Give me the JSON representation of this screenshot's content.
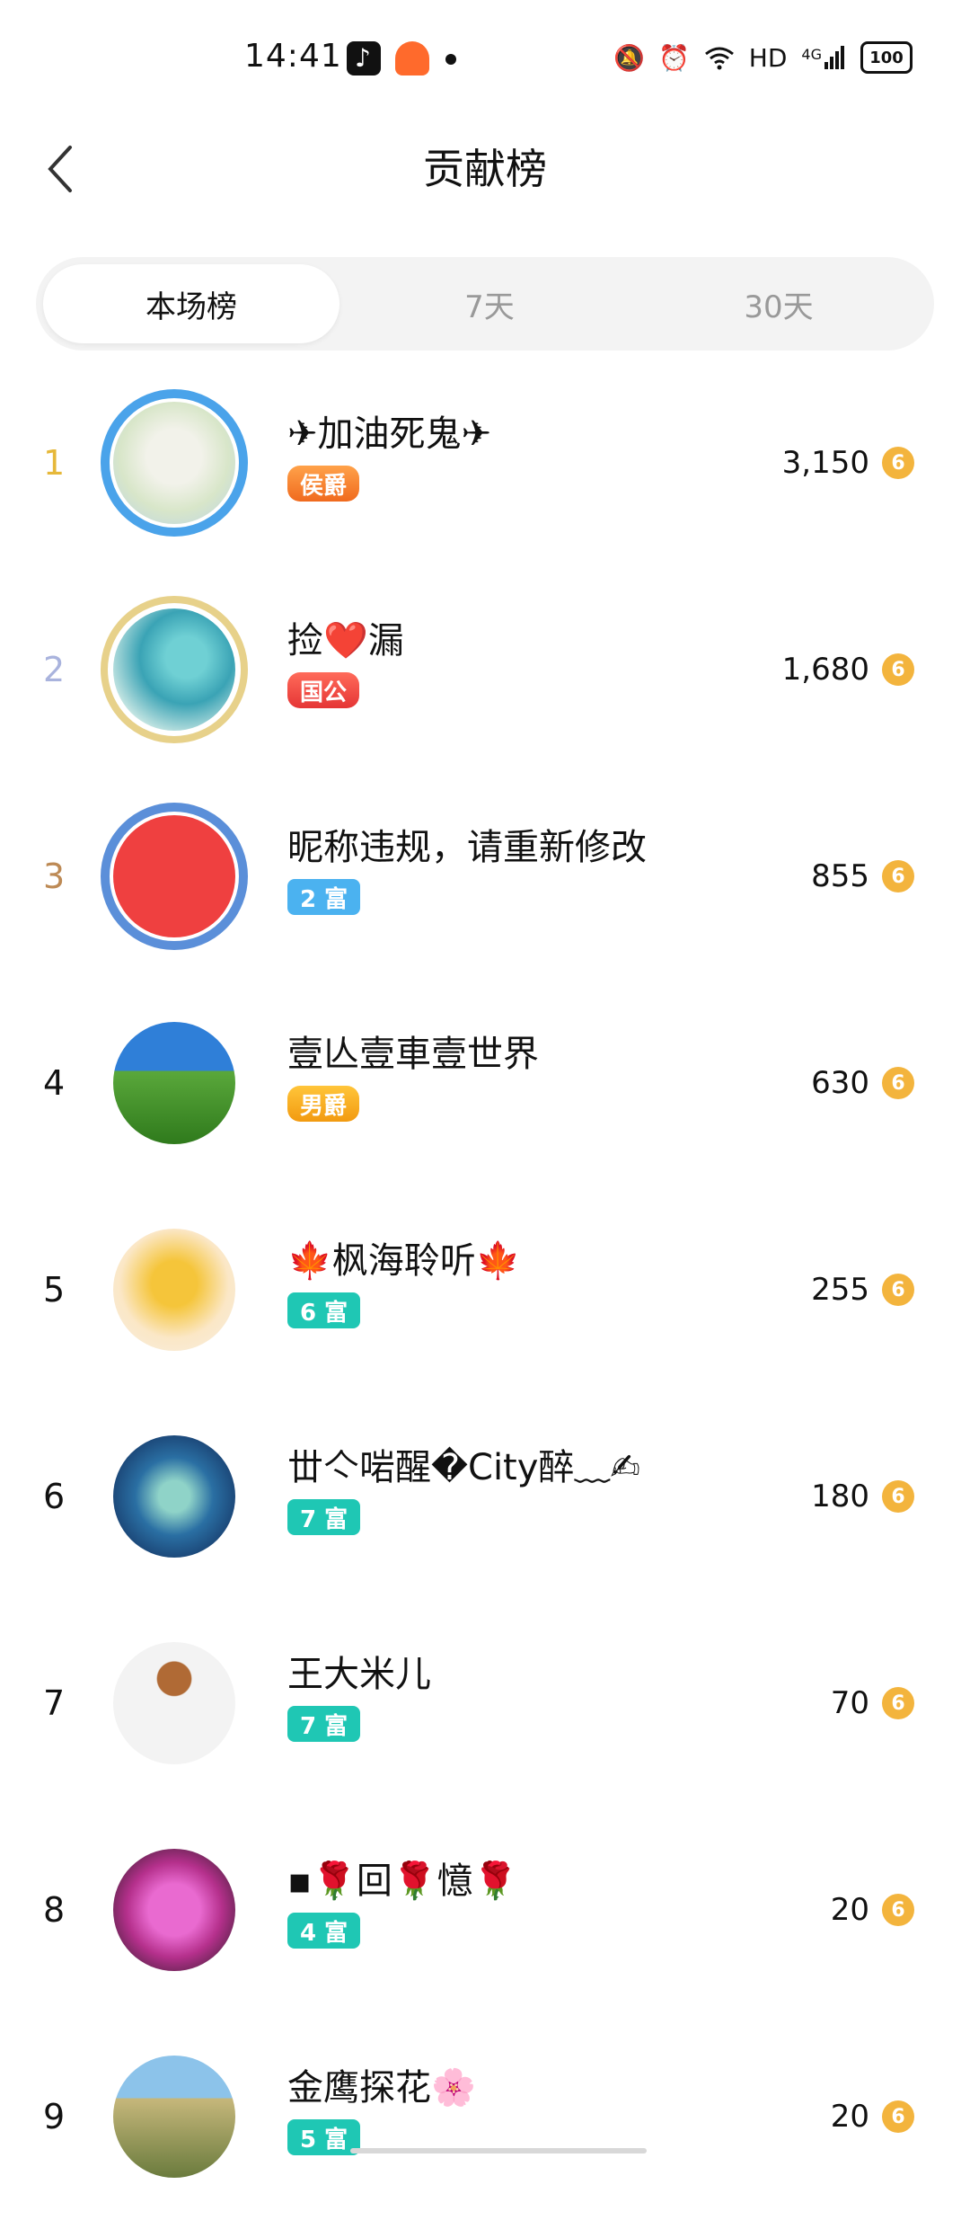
{
  "status_bar": {
    "time": "14:41",
    "icons": [
      "tiktok-icon",
      "robot-app-icon",
      "notification-dot",
      "mute-bell-icon",
      "alarm-icon",
      "wifi-icon",
      "hd-icon",
      "signal-4g-icon",
      "battery-icon"
    ],
    "hd": "HD",
    "network": "4G",
    "battery": "100"
  },
  "header": {
    "title": "贡献榜"
  },
  "tabs": [
    {
      "label": "本场榜",
      "active": true
    },
    {
      "label": "7天",
      "active": false
    },
    {
      "label": "30天",
      "active": false
    }
  ],
  "rows": [
    {
      "rank": "1",
      "name": "✈加油死鬼✈",
      "badge": "侯爵",
      "score": "3,150"
    },
    {
      "rank": "2",
      "name": "捡❤️漏",
      "badge": "国公",
      "score": "1,680"
    },
    {
      "rank": "3",
      "name": "昵称违规，请重新修改",
      "badge": "2 富",
      "score": "855"
    },
    {
      "rank": "4",
      "name": "壹亾壹車壹世界",
      "badge": "男爵",
      "score": "630"
    },
    {
      "rank": "5",
      "name": "🍁枫海聆听🍁",
      "badge": "6 富",
      "score": "255"
    },
    {
      "rank": "6",
      "name": "丗亽啱醒�City醉﹏✍",
      "badge": "7 富",
      "score": "180"
    },
    {
      "rank": "7",
      "name": "王大米儿",
      "badge": "7 富",
      "score": "70"
    },
    {
      "rank": "8",
      "name": "▪🌹回🌹憶🌹",
      "badge": "4 富",
      "score": "20"
    },
    {
      "rank": "9",
      "name": "金鹰探花🌸",
      "badge": "5 富",
      "score": "20"
    }
  ],
  "coin_symbol": "6",
  "colors": {
    "rank1": "#e6b83a",
    "rank2": "#a9b3dd",
    "rank3": "#bd8a55",
    "fortune_badge": "#1fc7b4",
    "coin": "#f3b43d"
  }
}
